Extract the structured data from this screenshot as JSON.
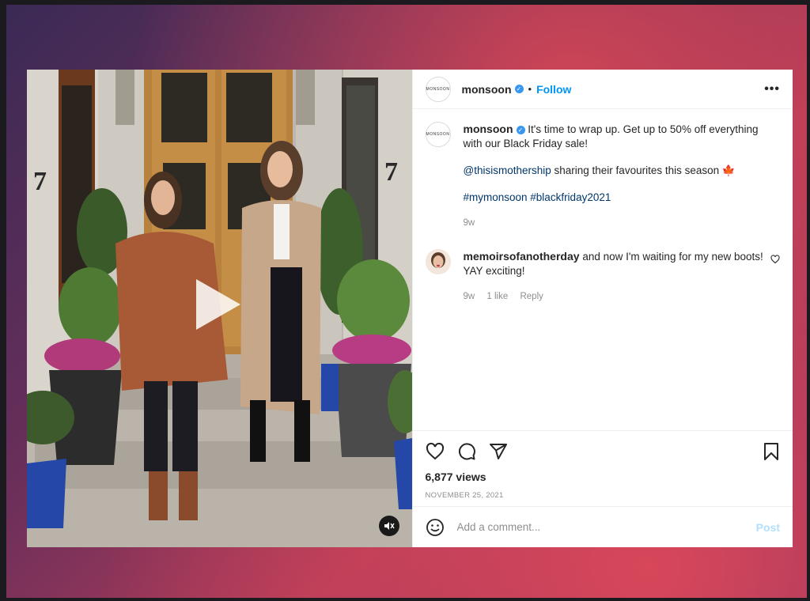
{
  "post": {
    "username": "monsoon",
    "avatar_text": "MONSOON",
    "follow_label": "Follow",
    "more_label": "•••",
    "separator": "•"
  },
  "caption": {
    "username": "monsoon",
    "text": "It's time to wrap up. Get up to 50% off everything with our Black Friday sale!",
    "mention": "@thisismothership",
    "mention_text": "sharing their favourites this season 🍁",
    "hashtags": "#mymonsoon #blackfriday2021",
    "time": "9w"
  },
  "comments": [
    {
      "username": "memoirsofanotherday",
      "text": "and now I'm waiting for my new boots! YAY exciting!",
      "time": "9w",
      "likes": "1 like",
      "reply_label": "Reply"
    }
  ],
  "stats": {
    "views": "6,877 views",
    "date": "NOVEMBER 25, 2021"
  },
  "composer": {
    "placeholder": "Add a comment...",
    "post_label": "Post"
  },
  "media": {
    "house_number": "7"
  },
  "colors": {
    "accent": "#0095f6",
    "verified": "#3897f0",
    "link": "#00376b"
  }
}
